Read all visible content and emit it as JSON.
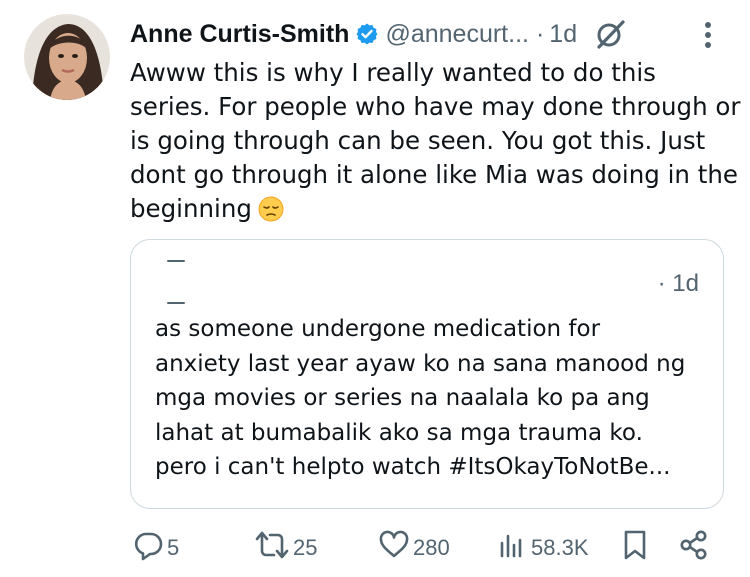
{
  "tweet": {
    "author": {
      "name": "Anne Curtis-Smith",
      "handle": "@annecurt...",
      "verified": true
    },
    "separator": "·",
    "time": "1d",
    "text_lines": [
      "Awww this is why I really wanted to do this",
      "series. For people who have may done through or",
      "is going through can be seen. You got this. Just",
      "dont go through it alone like Mia was doing in the",
      "beginning"
    ],
    "emoji": "pensive-face-emoji",
    "quoted": {
      "separator": "·",
      "time": "1d",
      "text_lines": [
        "as someone undergone medication for",
        "anxiety last year ayaw ko na sana manood ng",
        "mga movies or series na naalala ko pa ang",
        "lahat at bumabalik ako sa mga trauma ko.",
        "pero i can't helpto watch #ItsOkayToNotBe..."
      ]
    },
    "stats": {
      "replies": "5",
      "reposts": "25",
      "likes": "280",
      "views": "58.3K"
    }
  },
  "colors": {
    "text_primary": "#0f1419",
    "text_secondary": "#536471",
    "verified_badge": "#1d9bf0",
    "border": "#cfd9de"
  },
  "icons": [
    "verified-badge-icon",
    "grok-icon",
    "more-icon",
    "reply-icon",
    "repost-icon",
    "like-icon",
    "views-icon",
    "bookmark-icon",
    "share-icon"
  ]
}
